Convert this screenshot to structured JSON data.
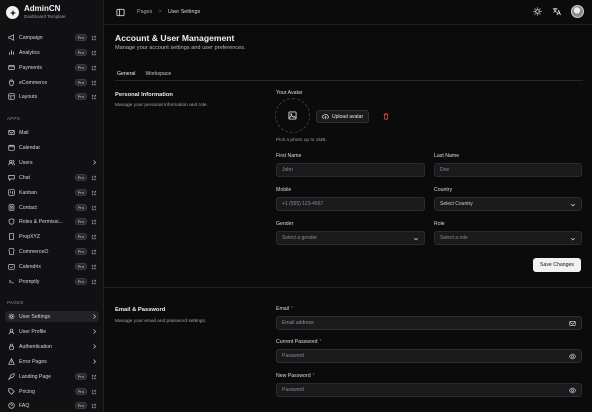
{
  "brand": {
    "title": "AdminCN",
    "subtitle": "Dashboard Template"
  },
  "sidebar": {
    "top_items": [
      {
        "label": "Campaign",
        "badge": "Pro"
      },
      {
        "label": "Analytics",
        "badge": "Pro"
      },
      {
        "label": "Payments",
        "badge": "Pro"
      },
      {
        "label": "eCommerce",
        "badge": "Pro"
      },
      {
        "label": "Layouts",
        "badge": "Pro"
      }
    ],
    "apps_label": "APPS",
    "apps_items": [
      {
        "label": "Mail"
      },
      {
        "label": "Calendar"
      },
      {
        "label": "Users"
      },
      {
        "label": "Chat",
        "badge": "Pro"
      },
      {
        "label": "Kanban",
        "badge": "Pro"
      },
      {
        "label": "Contact",
        "badge": "Pro"
      },
      {
        "label": "Roles & Permissi...",
        "badge": "Pro"
      },
      {
        "label": "PropXYZ",
        "badge": "Pro"
      },
      {
        "label": "CommerceO",
        "badge": "Pro"
      },
      {
        "label": "Calendrix",
        "badge": "Pro"
      },
      {
        "label": "Promptly",
        "badge": "Pro"
      }
    ],
    "pages_label": "PAGES",
    "pages_items": [
      {
        "label": "User Settings"
      },
      {
        "label": "User Profile"
      },
      {
        "label": "Authentication"
      },
      {
        "label": "Error Pages"
      },
      {
        "label": "Landing Page",
        "badge": "Pro"
      },
      {
        "label": "Pricing",
        "badge": "Pro"
      },
      {
        "label": "FAQ",
        "badge": "Pro"
      }
    ]
  },
  "breadcrumb": {
    "parent": "Pages",
    "separator": ">",
    "current": "User Settings"
  },
  "page": {
    "title": "Account & User Management",
    "description": "Manage your account settings and user preferences."
  },
  "tabs": [
    {
      "label": "General"
    },
    {
      "label": "Workspace"
    }
  ],
  "personal": {
    "title": "Personal Information",
    "description": "Manage your personal information and role.",
    "avatar_label": "Your Avatar",
    "upload_label": "Upload avatar",
    "hint": "Pick a photo up to 1MB.",
    "first_name_label": "First Name",
    "first_name_placeholder": "John",
    "last_name_label": "Last Name",
    "last_name_placeholder": "Doe",
    "mobile_label": "Mobile",
    "mobile_placeholder": "+1 (555) 123-4567",
    "country_label": "Country",
    "country_value": "Select Country",
    "gender_label": "Gender",
    "gender_placeholder": "Select a gender",
    "role_label": "Role",
    "role_placeholder": "Select a role",
    "save_label": "Save Changes"
  },
  "email_password": {
    "title": "Email & Password",
    "description": "Manage your email and password settings.",
    "email_label": "Email",
    "email_placeholder": "Email address",
    "current_password_label": "Current Password",
    "current_password_placeholder": "Password",
    "new_password_label": "New Password",
    "new_password_placeholder": "Password",
    "required_mark": "*"
  }
}
